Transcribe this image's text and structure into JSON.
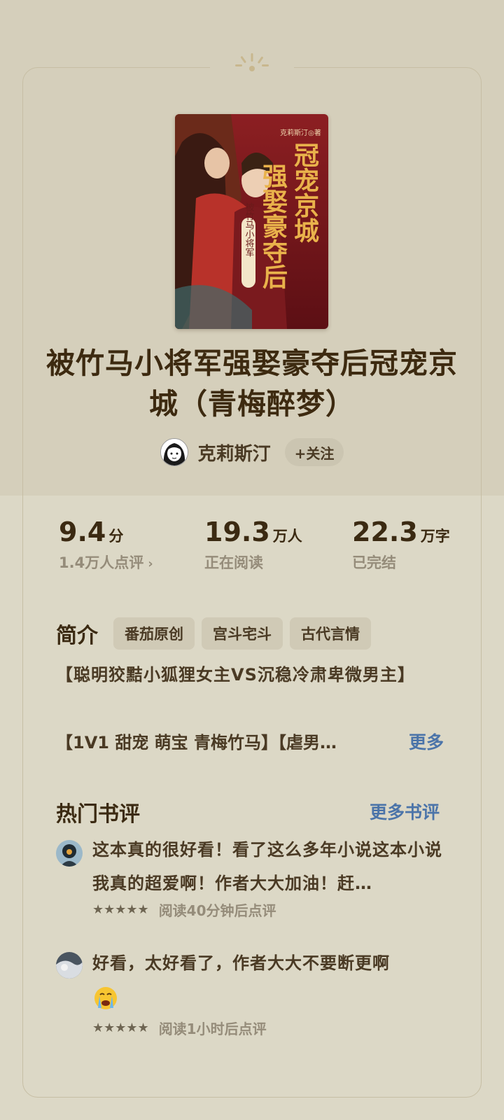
{
  "book": {
    "cover_author": "克莉斯汀◎著",
    "cover_title_a": "强娶豪夺后",
    "cover_title_b": "冠宠京城",
    "cover_subtitle": "被竹马小将军",
    "title": "被竹马小将军强娶豪夺后冠宠京城（青梅醉梦）"
  },
  "author": {
    "name": "克莉斯汀",
    "follow_label": "+关注"
  },
  "stats": {
    "score": "9.4",
    "score_unit": "分",
    "score_sub": "1.4万人点评",
    "readers": "19.3",
    "readers_unit": "万人",
    "readers_sub": "正在阅读",
    "words": "22.3",
    "words_unit": "万字",
    "words_sub": "已完结"
  },
  "intro": {
    "title": "简介",
    "tags": [
      "番茄原创",
      "宫斗宅斗",
      "古代言情"
    ],
    "text": "【聪明狡黠小狐狸女主VS沉稳冷肃卑微男主】",
    "last_line": "【1V1  甜宠  萌宝  青梅竹马】【虐男…",
    "more_label": "更多"
  },
  "reviews": {
    "title": "热门书评",
    "more_label": "更多书评",
    "items": [
      {
        "text": "这本真的很好看！看了这么多年小说这本小说我真的超爱啊！作者大大加油！赶…",
        "stars": "★★★★★",
        "meta": "阅读40分钟后点评"
      },
      {
        "text": "好看，太好看了，作者大大不要断更啊",
        "stars": "★★★★★",
        "meta": "阅读1小时后点评"
      }
    ]
  },
  "colors": {
    "background": "#d9d4c1",
    "title_brown": "#3d2a10",
    "link_blue": "#4b74a9",
    "muted": "#958c7a"
  }
}
